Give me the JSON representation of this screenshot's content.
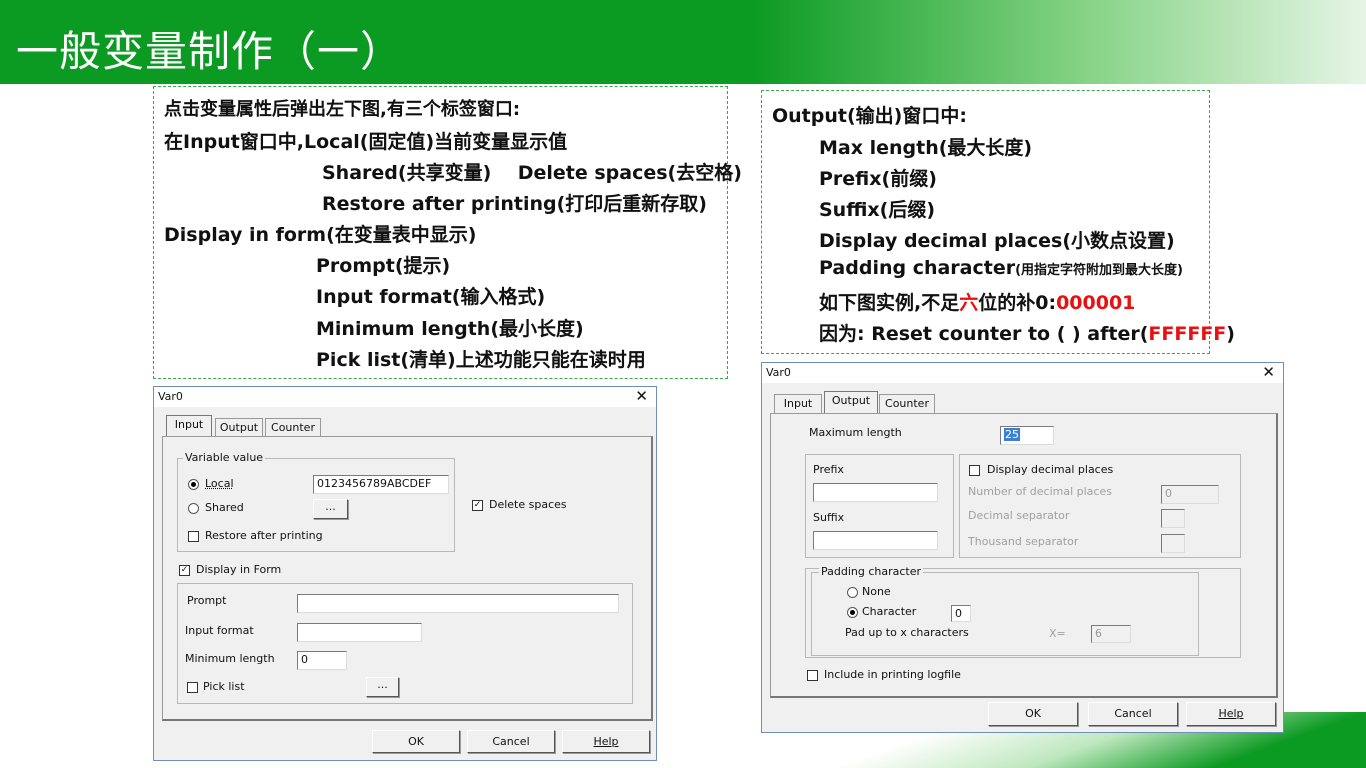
{
  "slide": {
    "title": "一般变量制作（一）",
    "left_note": [
      "点击变量属性后弹出左下图,有三个标签窗口:",
      "在Input窗口中,Local(固定值)当前变量显示值",
      "Shared(共享变量)    Delete spaces(去空格)",
      "Restore after printing(打印后重新存取)",
      "Display in form(在变量表中显示)",
      "Prompt(提示)",
      "Input format(输入格式)",
      "Minimum length(最小长度)",
      "Pick list(清单)上述功能只能在读时用"
    ],
    "right_note": {
      "line1": "Output(输出)窗口中:",
      "line2": "Max length(最大长度)",
      "line3": "Prefix(前缀)",
      "line4": "Suffix(后缀)",
      "line5": "Display decimal places(小数点设置)",
      "line6_main": "Padding character",
      "line6_small": "(用指定字符附加到最大长度)",
      "line7_a": "如下图实例,不足",
      "line7_red": "六",
      "line7_b": "位的补0:",
      "line7_red2": "000001",
      "line8_a": "因为: Reset counter to ( ) after(",
      "line8_red": "FFFFFF",
      "line8_b": ")"
    }
  },
  "dialog_input": {
    "title": "Var0",
    "close": "✕",
    "tabs": [
      "Input",
      "Output",
      "Counter"
    ],
    "variable_value_group": "Variable value",
    "local_label": "Local",
    "local_value": "0123456789ABCDEF",
    "shared_label": "Shared",
    "ellipsis": "...",
    "restore_label": "Restore after printing",
    "delete_spaces_label": "Delete spaces",
    "display_in_form_label": "Display in Form",
    "prompt_label": "Prompt",
    "prompt_value": "",
    "input_format_label": "Input format",
    "input_format_value": "",
    "min_length_label": "Minimum length",
    "min_length_value": "0",
    "pick_list_label": "Pick list",
    "ok": "OK",
    "cancel": "Cancel",
    "help": "Help"
  },
  "dialog_output": {
    "title": "Var0",
    "close": "✕",
    "tabs": [
      "Input",
      "Output",
      "Counter"
    ],
    "max_length_label": "Maximum length",
    "max_length_value": "25",
    "prefix_label": "Prefix",
    "prefix_value": "",
    "suffix_label": "Suffix",
    "suffix_value": "",
    "display_decimal_label": "Display decimal places",
    "num_decimal_label": "Number of decimal places",
    "num_decimal_value": "0",
    "decimal_sep_label": "Decimal separator",
    "thousand_sep_label": "Thousand separator",
    "padding_group": "Padding character",
    "none_label": "None",
    "character_label": "Character",
    "character_value": "0",
    "pad_up_label": "Pad up to x characters",
    "x_label": "X=",
    "x_value": "6",
    "include_log_label": "Include in printing logfile",
    "ok": "OK",
    "cancel": "Cancel",
    "help": "Help"
  }
}
